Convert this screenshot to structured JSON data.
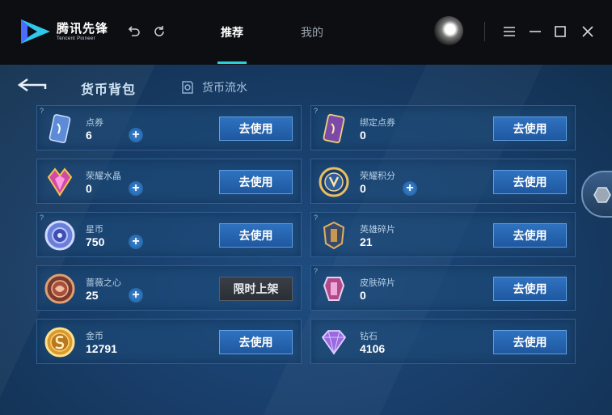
{
  "app": {
    "brand_cn": "腾讯先锋",
    "brand_en": "Tencent Pioneer"
  },
  "nav": {
    "tabs": [
      {
        "label": "推荐",
        "active": true
      },
      {
        "label": "我的",
        "active": false
      }
    ]
  },
  "page": {
    "title": "货币背包",
    "flow_link": "货币流水"
  },
  "colors": {
    "accent": "#2ad0d8",
    "button": "#2567b0",
    "card_bg": "#1e4a78"
  },
  "currencies": [
    {
      "name": "点券",
      "value": "6",
      "button": "去使用",
      "plus": true,
      "help": true,
      "icon": "voucher-icon"
    },
    {
      "name": "绑定点券",
      "value": "0",
      "button": "去使用",
      "plus": false,
      "help": true,
      "icon": "bound-voucher-icon"
    },
    {
      "name": "荣耀水晶",
      "value": "0",
      "button": "去使用",
      "plus": true,
      "help": false,
      "icon": "glory-crystal-icon"
    },
    {
      "name": "荣耀积分",
      "value": "0",
      "button": "去使用",
      "plus": true,
      "help": false,
      "icon": "glory-points-icon"
    },
    {
      "name": "星币",
      "value": "750",
      "button": "去使用",
      "plus": true,
      "help": true,
      "icon": "star-coin-icon"
    },
    {
      "name": "英雄碎片",
      "value": "21",
      "button": "去使用",
      "plus": false,
      "help": true,
      "icon": "hero-fragment-icon"
    },
    {
      "name": "蔷薇之心",
      "value": "25",
      "button": "限时上架",
      "plus": true,
      "help": false,
      "icon": "rose-heart-icon"
    },
    {
      "name": "皮肤碎片",
      "value": "0",
      "button": "去使用",
      "plus": false,
      "help": true,
      "icon": "skin-fragment-icon"
    },
    {
      "name": "金币",
      "value": "12791",
      "button": "去使用",
      "plus": false,
      "help": false,
      "icon": "gold-coin-icon"
    },
    {
      "name": "钻石",
      "value": "4106",
      "button": "去使用",
      "plus": false,
      "help": false,
      "icon": "diamond-icon"
    }
  ],
  "plus_label": "+",
  "help_label": "?"
}
